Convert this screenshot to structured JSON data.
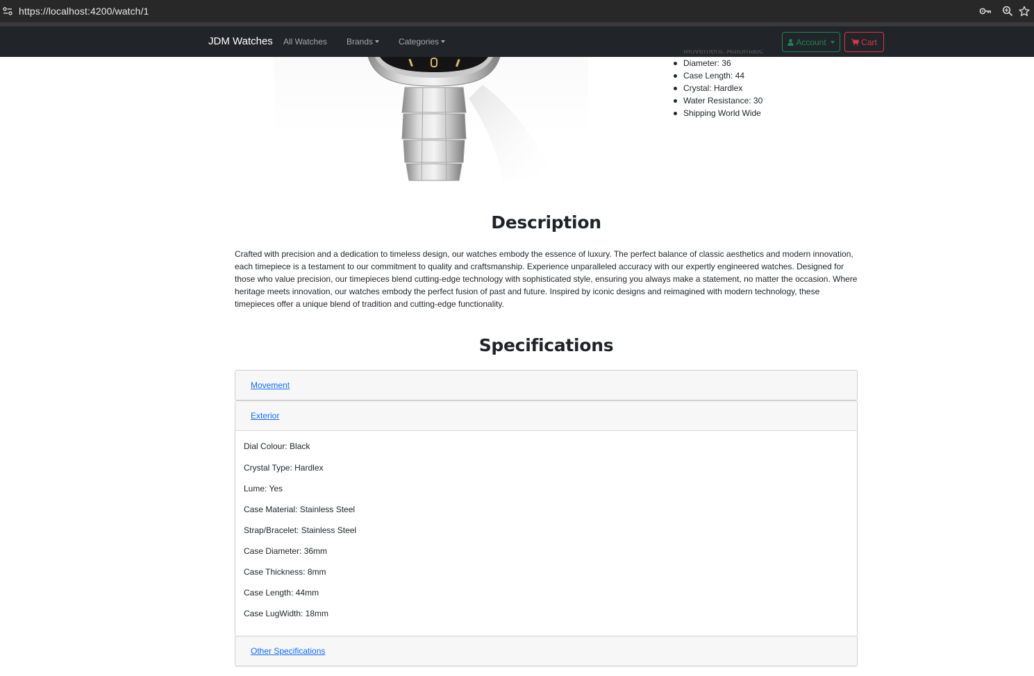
{
  "browser": {
    "url": "https://localhost:4200/watch/1",
    "icons": [
      "site-info-icon",
      "key-icon",
      "zoom-icon",
      "bookmark-star-icon"
    ]
  },
  "navbar": {
    "brand": "JDM Watches",
    "links": {
      "all_watches": "All Watches",
      "brands": "Brands",
      "categories": "Categories"
    },
    "account_label": "Account",
    "cart_label": "Cart",
    "colors": {
      "background": "#212529",
      "account": "#198754",
      "cart": "#dc3545"
    }
  },
  "quick_specs": {
    "items": [
      "Movement: Automatic",
      "Diameter: 36",
      "Case Length: 44",
      "Crystal: Hardlex",
      "Water Resistance: 30",
      "Shipping World Wide"
    ]
  },
  "description": {
    "title": "Description",
    "text": "Crafted with precision and a dedication to timeless design, our watches embody the essence of luxury. The perfect balance of classic aesthetics and modern innovation, each timepiece is a testament to our commitment to quality and craftsmanship. Experience unparalleled accuracy with our expertly engineered watches. Designed for those who value precision, our timepieces blend cutting-edge technology with sophisticated style, ensuring you always make a statement, no matter the occasion. Where heritage meets innovation, our watches embody the perfect fusion of past and future. Inspired by iconic designs and reimagined with modern technology, these timepieces offer a unique blend of tradition and cutting-edge functionality."
  },
  "specifications": {
    "title": "Specifications",
    "sections": {
      "movement": {
        "label": "Movement",
        "expanded": false
      },
      "exterior": {
        "label": "Exterior",
        "expanded": true,
        "items": [
          "Dial Colour: Black",
          "Crystal Type: Hardlex",
          "Lume: Yes",
          "Case Material: Stainless Steel",
          "Strap/Bracelet: Stainless Steel",
          "Case Diameter: 36mm",
          "Case Thickness: 8mm",
          "Case Length: 44mm",
          "Case LugWidth: 18mm"
        ]
      },
      "other": {
        "label": "Other Specifications",
        "expanded": false
      }
    },
    "link_color": "#0d6efd"
  }
}
